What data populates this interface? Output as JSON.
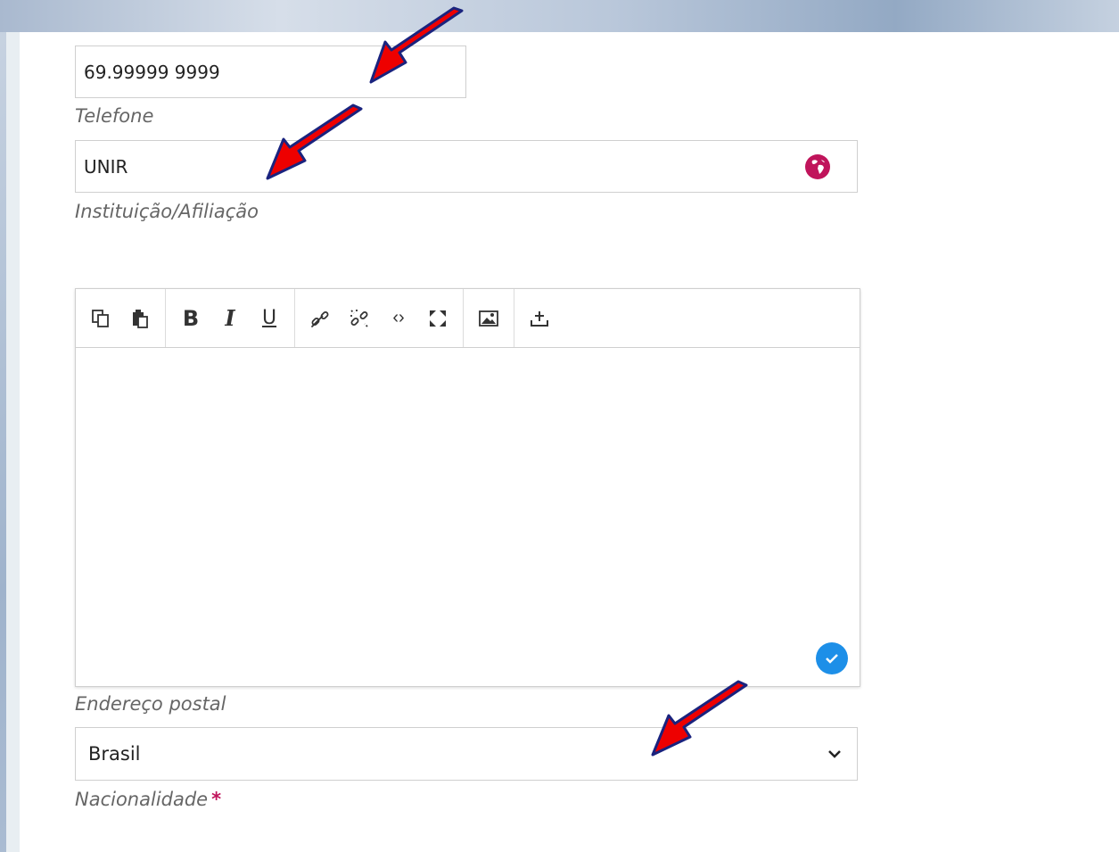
{
  "phone": {
    "value": "69.99999 9999",
    "label": "Telefone"
  },
  "institution": {
    "value": "UNIR",
    "label": "Instituição/Afiliação",
    "icon": "globe-icon"
  },
  "editor": {
    "label": "Endereço postal",
    "toolbar": [
      "copy-icon",
      "paste-icon",
      "bold-icon",
      "italic-icon",
      "underline-icon",
      "link-icon",
      "unlink-icon",
      "code-icon",
      "fullscreen-icon",
      "image-icon",
      "upload-icon"
    ],
    "bold_glyph": "B",
    "italic_glyph": "I",
    "underline_glyph": "U",
    "code_glyph": "‹›",
    "value": ""
  },
  "nationality": {
    "value": "Brasil",
    "label": "Nacionalidade",
    "required_mark": "*"
  },
  "colors": {
    "accent": "#c0145b",
    "check": "#1d8fe8",
    "arrow": "#ee0000"
  }
}
